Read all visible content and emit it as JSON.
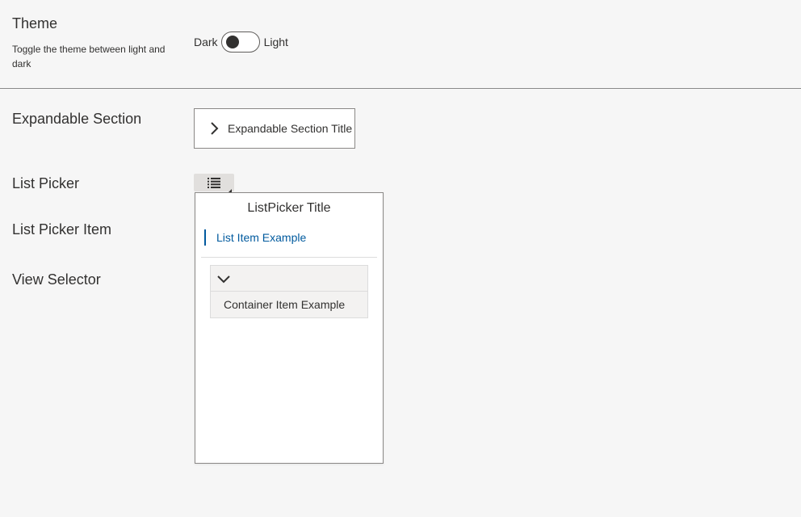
{
  "theme": {
    "title": "Theme",
    "description": "Toggle the theme between light and dark",
    "toggle": {
      "left_label": "Dark",
      "right_label": "Light",
      "state": "dark"
    }
  },
  "rows": {
    "expandable_section_label": "Expandable Section",
    "list_picker_label": "List Picker",
    "list_picker_item_label": "List Picker Item",
    "view_selector_label": "View Selector"
  },
  "expandable": {
    "title": "Expandable Section Title",
    "icon": "chevron-right-icon"
  },
  "list_picker": {
    "button_icon": "list-icon",
    "flyout_title": "ListPicker Title",
    "list_item": "List Item Example",
    "container": {
      "header_icon": "chevron-down-icon",
      "item": "Container Item Example"
    }
  },
  "colors": {
    "page_bg": "#f6f6f6",
    "accent": "#005a9e",
    "text": "#323130",
    "border": "#8a8886"
  }
}
